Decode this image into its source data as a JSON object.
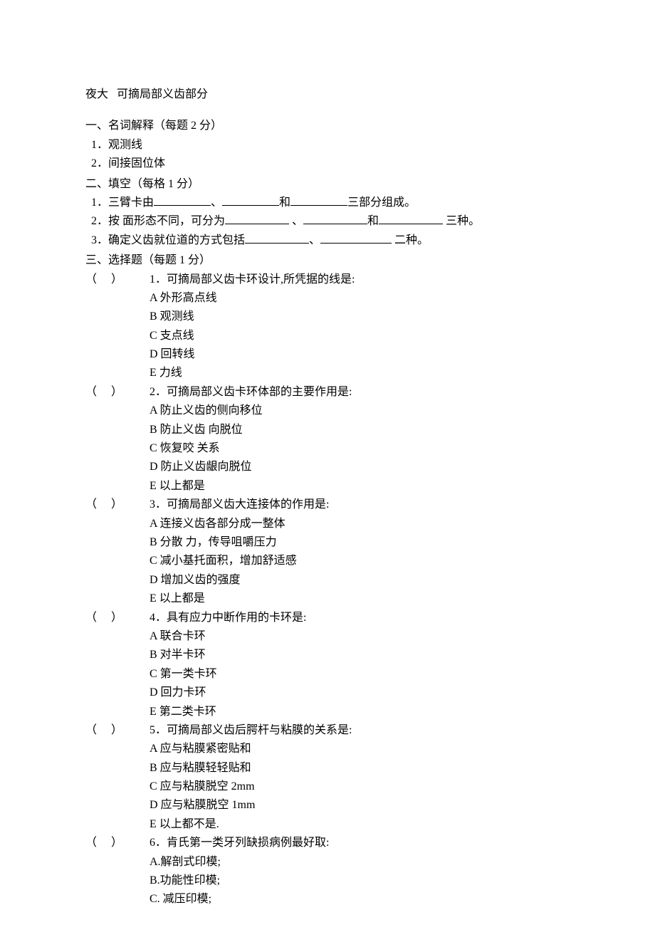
{
  "title": {
    "prefix": "夜大",
    "main": "可摘局部义齿部分"
  },
  "section1": {
    "heading": "一、名词解释（每题 2 分）",
    "items": [
      "1．观测线",
      "2．间接固位体"
    ]
  },
  "section2": {
    "heading": "二、填空（每格 1 分）",
    "items": [
      {
        "num": "1．",
        "pre": "三臂卡由",
        "sep1": "、",
        "sep2": "和",
        "tail": "三部分组成。"
      },
      {
        "num": "2．",
        "pre": "按   面形态不同，可分为",
        "sep1": " 、",
        "sep2": "和",
        "tail": "  三种。"
      },
      {
        "num": "3．",
        "pre": "确定义齿就位道的方式包括",
        "sep1": "、",
        "tail": "  二种。"
      }
    ]
  },
  "section3": {
    "heading": "三、选择题（每题 1 分）",
    "paren": "（     ）",
    "questions": [
      {
        "stem": "1．可摘局部义齿卡环设计,所凭据的线是:",
        "options": [
          "A  外形高点线",
          "B  观测线",
          "C  支点线",
          "D  回转线",
          "E     力线"
        ]
      },
      {
        "stem": "2．可摘局部义齿卡环体部的主要作用是:",
        "options": [
          "A 防止义齿的侧向移位",
          "B 防止义齿   向脱位",
          "C 恢复咬   关系",
          "D 防止义齿龈向脱位",
          "E 以上都是"
        ]
      },
      {
        "stem": "3．可摘局部义齿大连接体的作用是:",
        "options": [
          "A 连接义齿各部分成一整体",
          "B 分散   力，传导咀嚼压力",
          "C 减小基托面积，增加舒适感",
          "D 增加义齿的强度",
          "E 以上都是"
        ]
      },
      {
        "stem": "4．具有应力中断作用的卡环是:",
        "options": [
          "A 联合卡环",
          "B 对半卡环",
          "C 第一类卡环",
          "D 回力卡环",
          "E 第二类卡环"
        ]
      },
      {
        "stem": "5．可摘局部义齿后腭杆与粘膜的关系是:",
        "options": [
          "A 应与粘膜紧密贴和",
          "B 应与粘膜轻轻贴和",
          "C 应与粘膜脱空 2mm",
          "D 应与粘膜脱空 1mm",
          "E 以上都不是."
        ]
      },
      {
        "stem": "6．肯氏第一类牙列缺损病例最好取:",
        "options": [
          "A.解剖式印模;",
          "B.功能性印模;",
          "C. 减压印模;"
        ]
      }
    ]
  }
}
